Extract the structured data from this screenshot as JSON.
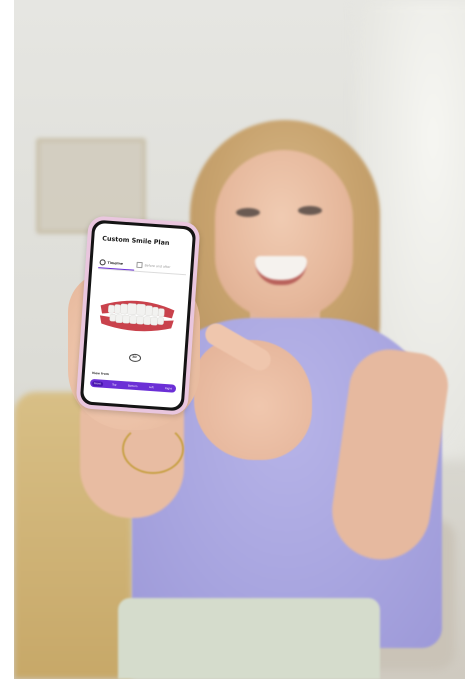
{
  "phone_app": {
    "title": "Custom Smile Plan",
    "tabs": [
      {
        "label": "Timeline",
        "icon": "clock-icon",
        "active": true
      },
      {
        "label": "Before and after",
        "icon": "compare-icon",
        "active": false
      }
    ],
    "rotate_label": "3D",
    "view_from_label": "View from",
    "view_options": [
      {
        "label": "Front",
        "active": true
      },
      {
        "label": "Top",
        "active": false
      },
      {
        "label": "Bottom",
        "active": false
      },
      {
        "label": "Left",
        "active": false
      },
      {
        "label": "Right",
        "active": false
      }
    ]
  },
  "colors": {
    "accent": "#6b2fd6",
    "phone_case": "#e9c6de",
    "shirt": "#a7a4df"
  }
}
